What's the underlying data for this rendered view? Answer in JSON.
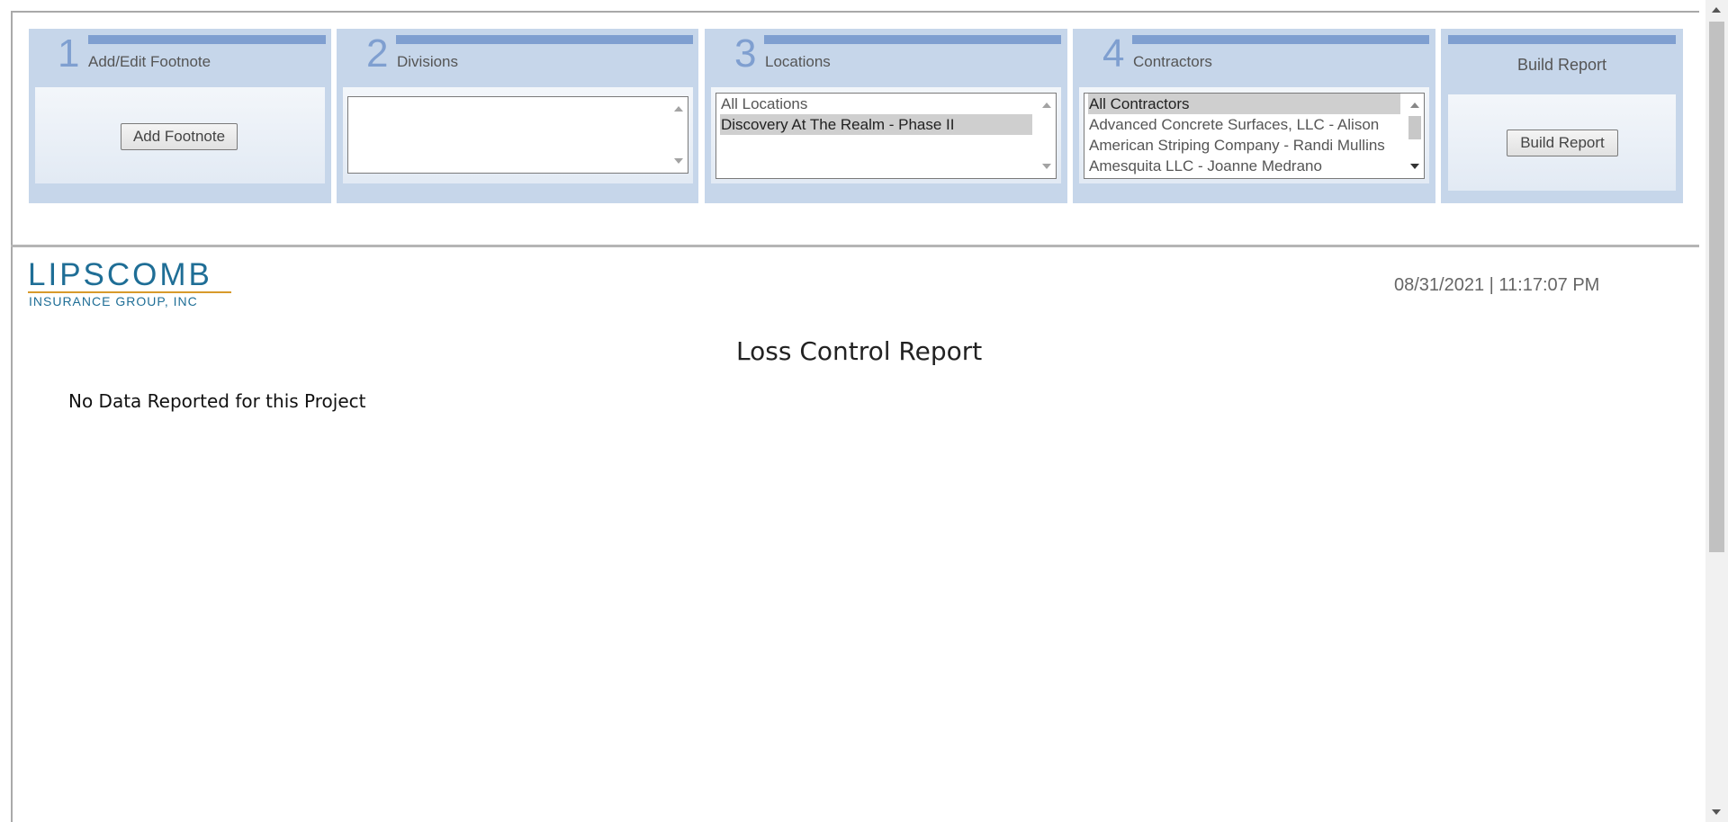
{
  "panels": [
    {
      "num": "1",
      "title": "Add/Edit Footnote",
      "button_label": "Add Footnote"
    },
    {
      "num": "2",
      "title": "Divisions",
      "options": []
    },
    {
      "num": "3",
      "title": "Locations",
      "options": [
        "All Locations",
        "Discovery At The Realm - Phase II"
      ],
      "selected": "Discovery At The Realm - Phase II"
    },
    {
      "num": "4",
      "title": "Contractors",
      "options": [
        "All Contractors",
        "Advanced Concrete Surfaces, LLC - Alison",
        "American Striping Company - Randi Mullins",
        "Amesquita LLC - Joanne Medrano"
      ],
      "selected": "All Contractors"
    },
    {
      "num": "",
      "title": "Build Report",
      "button_label": "Build Report"
    }
  ],
  "report": {
    "logo_main": "LIPSCOMB",
    "logo_sub": "INSURANCE GROUP, INC",
    "timestamp": "08/31/2021 | 11:17:07 PM",
    "title": "Loss Control Report",
    "message": "No Data Reported for this Project"
  },
  "colors": {
    "panel_bg": "#c6d6ea",
    "accent_bar": "#7f9fd0",
    "logo_blue": "#1f6e96",
    "logo_gold": "#d89a2b"
  },
  "icons": [
    "scroll-up-arrow-icon",
    "scroll-down-arrow-icon"
  ]
}
